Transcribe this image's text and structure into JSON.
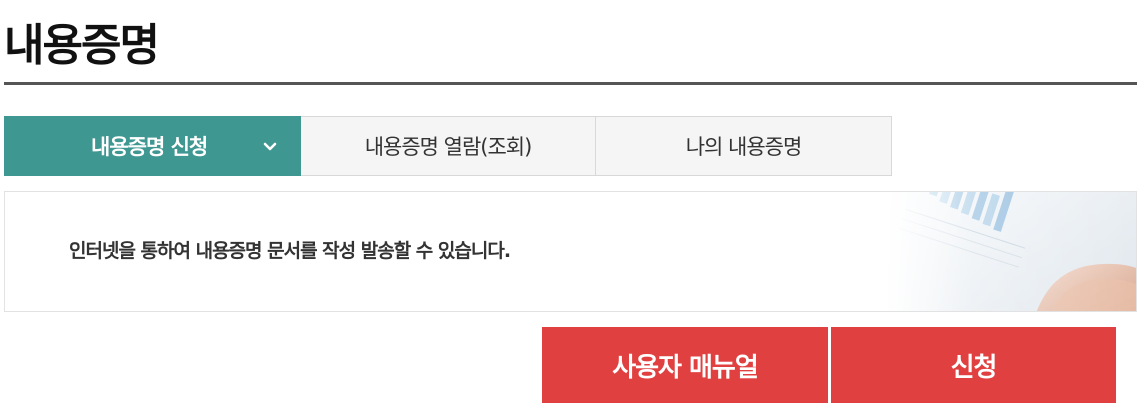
{
  "page": {
    "title": "내용증명"
  },
  "tabs": [
    {
      "label": "내용증명 신청",
      "active": true,
      "icon": "chevron-down-icon"
    },
    {
      "label": "내용증명 열람(조회)",
      "active": false
    },
    {
      "label": "나의 내용증명",
      "active": false
    }
  ],
  "info": {
    "text": "인터넷을 통하여 내용증명 문서를 작성 발송할 수 있습니다."
  },
  "actions": {
    "manual_label": "사용자 매뉴얼",
    "apply_label": "신청"
  },
  "colors": {
    "tab_active": "#3f9792",
    "button": "#e04040",
    "rule": "#555555"
  }
}
